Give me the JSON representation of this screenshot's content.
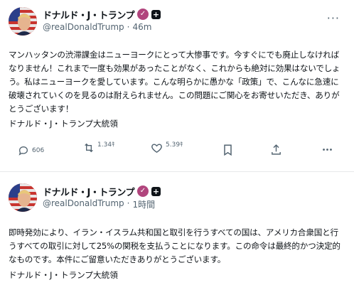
{
  "posts": [
    {
      "author": "ドナルド・J・トランプ",
      "handle": "@realDonaldTrump",
      "time": "46m",
      "body": "マンハッタンの渋滞課金はニューヨークにとって大惨事です。今すぐにでも廃止しなければなりません！これまで一度も効果があったことがなく、これからも絶対に効果はないでしょう。私はニューヨークを愛しています。こんな明らかに愚かな「政策」で、こんなに急速に破壊されていくのを見るのは耐えられません。この問題にご関心をお寄せいただき、ありがとうございます！",
      "signature": "ドナルド・J・トランプ大統領",
      "stats": {
        "replies": "606",
        "reposts": "1.34ｷ",
        "likes": "5.39ｷ"
      }
    },
    {
      "author": "ドナルド・J・トランプ",
      "handle": "@realDonaldTrump",
      "time": "1時間",
      "body": "即時発効により、イラン・イスラム共和国と取引を行うすべての国は、アメリカ合衆国と行うすべての取引に対して25%の関税を支払うことになります。この命令は最終的かつ決定的なものです。本件にご留意いただきありがとうございます。",
      "signature": "ドナルド・J・トランプ大統領"
    }
  ],
  "icons": {
    "verified": "check-badge",
    "gov": "plus-square-badge",
    "more": "ellipsis",
    "reply": "speech-bubble",
    "repost": "repost-arrows",
    "like": "heart",
    "bookmark": "bookmark",
    "share": "upload-arrow"
  },
  "colors": {
    "verified_badge": "#b1457d",
    "muted_text": "#536471",
    "divider": "#e7e9ea"
  }
}
